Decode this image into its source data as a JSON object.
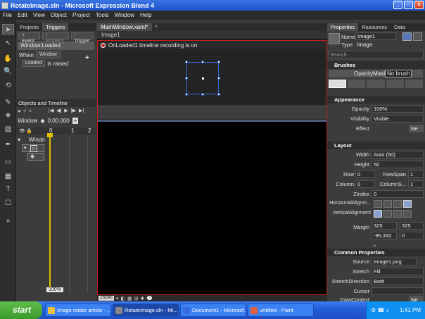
{
  "window": {
    "title": "RotateImage.sln - Microsoft Expression Blend 4"
  },
  "menu": [
    "File",
    "Edit",
    "View",
    "Object",
    "Project",
    "Tools",
    "Window",
    "Help"
  ],
  "left": {
    "tabs": [
      "Projects",
      "Triggers"
    ],
    "event_btn": "+ Event",
    "property_btn": "+ Property",
    "trigger_btn": "- Trigger",
    "trigger_item": "Window.Loaded",
    "when_label": "When",
    "when_value": "Window",
    "loaded_value": "Loaded",
    "raised_text": "is raised",
    "plus": "+",
    "timeline_title": "Objects and Timeline",
    "timeline_window": "Window",
    "time": "0:00.000",
    "tick0": "0",
    "tick1": "1",
    "tick2": "2",
    "tree_window": "Windo",
    "zoom": "100%"
  },
  "doc": {
    "tab": "MainWindow.xaml*",
    "breadcrumb": "Image1",
    "recording": "OnLoaded1 timeline recording is on",
    "zoom": "150%"
  },
  "right": {
    "tabs": [
      "Properties",
      "Resources",
      "Data"
    ],
    "name_label": "Name",
    "name_value": "Image1",
    "type_label": "Type",
    "type_value": "Image",
    "search_placeholder": "Search",
    "brushes": "Brushes",
    "opacitymask": "OpacityMask",
    "nobrush": "No brush",
    "appearance": "Appearance",
    "opacity_label": "Opacity",
    "opacity_value": "100%",
    "visibility_label": "Visibility",
    "visibility_value": "Visible",
    "effect_label": "Effect",
    "new_btn": "Ne",
    "layout": "Layout",
    "width_label": "Width",
    "width_value": "Auto (50)",
    "height_label": "Height",
    "height_value": "50",
    "row_label": "Row",
    "row_value": "0",
    "rowspan_label": "RowSpan",
    "rowspan_value": "1",
    "column_label": "Column",
    "column_value": "0",
    "columnspan_label": "ColumnS...",
    "columnspan_value": "1",
    "zindex_label": "ZIndex",
    "zindex_value": "0",
    "halign_label": "HorizontalAlignm...",
    "valign_label": "VerticalAlignment",
    "margin_label": "Margin",
    "margin_left": "325",
    "margin_right": "325",
    "margin_top": "-95.332",
    "margin_bottom": "0",
    "common": "Common Properties",
    "source_label": "Source",
    "source_value": "Image1.png",
    "stretch_label": "Stretch",
    "stretch_value": "Fill",
    "stretchdir_label": "StretchDirection",
    "stretchdir_value": "Both",
    "cursor_label": "Cursor",
    "datacontext_label": "DataContext",
    "new_btn2": "Ne"
  },
  "taskbar": {
    "start": "start",
    "tasks": [
      "Image rotate article - ...",
      "RotateImage.sln - Mi...",
      "Document1 - Microsof...",
      "untitled - Paint"
    ],
    "clock": "1:41 PM"
  },
  "colors": {
    "recording_red": "#c42020",
    "selection_blue": "#3a6ae0",
    "taskbar_blue": "#245edb"
  }
}
